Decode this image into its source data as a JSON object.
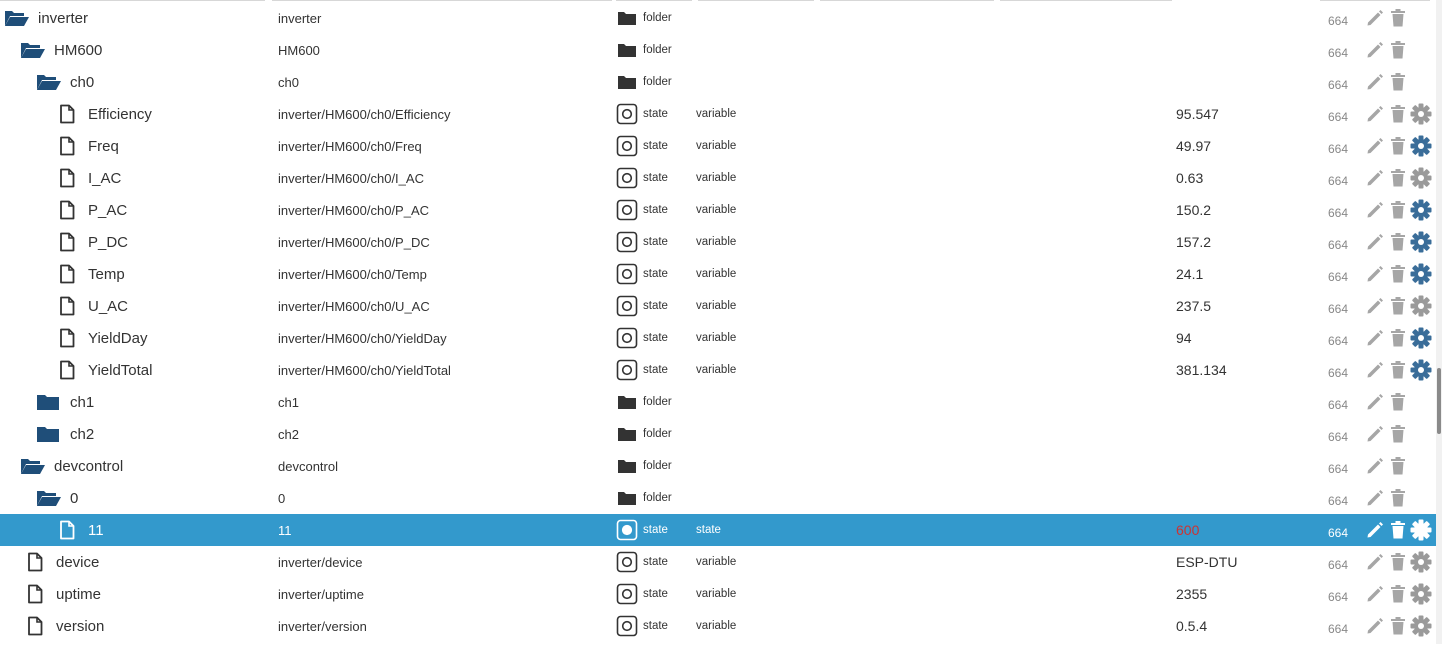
{
  "colors": {
    "folder": "#1f4e79",
    "selected_bg": "#3399cc",
    "gear_active": "#3a6d99",
    "gear_inactive": "#9a9a9a",
    "action_icon": "#a6a6a6",
    "value_red": "#cc3333"
  },
  "icons": {
    "folder_open": "folder-open-icon",
    "folder_closed": "folder-closed-icon",
    "file": "file-icon",
    "type_folder": "folder-icon",
    "type_state": "state-box-icon",
    "edit": "pencil-icon",
    "delete": "trash-icon",
    "settings": "gear-icon"
  },
  "rows": [
    {
      "name": "inverter",
      "id": "inverter",
      "type": "folder",
      "role": "",
      "value": "",
      "acl": "664",
      "kind": "folder_open",
      "depth": 0,
      "gear": "none",
      "selected": false
    },
    {
      "name": "HM600",
      "id": "HM600",
      "type": "folder",
      "role": "",
      "value": "",
      "acl": "664",
      "kind": "folder_open",
      "depth": 1,
      "gear": "none",
      "selected": false
    },
    {
      "name": "ch0",
      "id": "ch0",
      "type": "folder",
      "role": "",
      "value": "",
      "acl": "664",
      "kind": "folder_open",
      "depth": 2,
      "gear": "none",
      "selected": false
    },
    {
      "name": "Efficiency",
      "id": "inverter/HM600/ch0/Efficiency",
      "type": "state",
      "role": "variable",
      "value": "95.547",
      "acl": "664",
      "kind": "file",
      "depth": 3,
      "gear": "inactive",
      "selected": false
    },
    {
      "name": "Freq",
      "id": "inverter/HM600/ch0/Freq",
      "type": "state",
      "role": "variable",
      "value": "49.97",
      "acl": "664",
      "kind": "file",
      "depth": 3,
      "gear": "active",
      "selected": false
    },
    {
      "name": "I_AC",
      "id": "inverter/HM600/ch0/I_AC",
      "type": "state",
      "role": "variable",
      "value": "0.63",
      "acl": "664",
      "kind": "file",
      "depth": 3,
      "gear": "inactive",
      "selected": false
    },
    {
      "name": "P_AC",
      "id": "inverter/HM600/ch0/P_AC",
      "type": "state",
      "role": "variable",
      "value": "150.2",
      "acl": "664",
      "kind": "file",
      "depth": 3,
      "gear": "active",
      "selected": false
    },
    {
      "name": "P_DC",
      "id": "inverter/HM600/ch0/P_DC",
      "type": "state",
      "role": "variable",
      "value": "157.2",
      "acl": "664",
      "kind": "file",
      "depth": 3,
      "gear": "active",
      "selected": false
    },
    {
      "name": "Temp",
      "id": "inverter/HM600/ch0/Temp",
      "type": "state",
      "role": "variable",
      "value": "24.1",
      "acl": "664",
      "kind": "file",
      "depth": 3,
      "gear": "active",
      "selected": false
    },
    {
      "name": "U_AC",
      "id": "inverter/HM600/ch0/U_AC",
      "type": "state",
      "role": "variable",
      "value": "237.5",
      "acl": "664",
      "kind": "file",
      "depth": 3,
      "gear": "inactive",
      "selected": false
    },
    {
      "name": "YieldDay",
      "id": "inverter/HM600/ch0/YieldDay",
      "type": "state",
      "role": "variable",
      "value": "94",
      "acl": "664",
      "kind": "file",
      "depth": 3,
      "gear": "active",
      "selected": false
    },
    {
      "name": "YieldTotal",
      "id": "inverter/HM600/ch0/YieldTotal",
      "type": "state",
      "role": "variable",
      "value": "381.134",
      "acl": "664",
      "kind": "file",
      "depth": 3,
      "gear": "active",
      "selected": false
    },
    {
      "name": "ch1",
      "id": "ch1",
      "type": "folder",
      "role": "",
      "value": "",
      "acl": "664",
      "kind": "folder_closed",
      "depth": 2,
      "gear": "none",
      "selected": false
    },
    {
      "name": "ch2",
      "id": "ch2",
      "type": "folder",
      "role": "",
      "value": "",
      "acl": "664",
      "kind": "folder_closed",
      "depth": 2,
      "gear": "none",
      "selected": false
    },
    {
      "name": "devcontrol",
      "id": "devcontrol",
      "type": "folder",
      "role": "",
      "value": "",
      "acl": "664",
      "kind": "folder_open",
      "depth": 1,
      "gear": "none",
      "selected": false
    },
    {
      "name": "0",
      "id": "0",
      "type": "folder",
      "role": "",
      "value": "",
      "acl": "664",
      "kind": "folder_open",
      "depth": 2,
      "gear": "none",
      "selected": false
    },
    {
      "name": "11",
      "id": "11",
      "type": "state",
      "role": "state",
      "value": "600",
      "acl": "664",
      "kind": "file",
      "depth": 3,
      "gear": "active",
      "selected": true,
      "value_red": true
    },
    {
      "name": "device",
      "id": "inverter/device",
      "type": "state",
      "role": "variable",
      "value": "ESP-DTU",
      "acl": "664",
      "kind": "file",
      "depth": 1,
      "gear": "inactive",
      "selected": false
    },
    {
      "name": "uptime",
      "id": "inverter/uptime",
      "type": "state",
      "role": "variable",
      "value": "2355",
      "acl": "664",
      "kind": "file",
      "depth": 1,
      "gear": "inactive",
      "selected": false
    },
    {
      "name": "version",
      "id": "inverter/version",
      "type": "state",
      "role": "variable",
      "value": "0.5.4",
      "acl": "664",
      "kind": "file",
      "depth": 1,
      "gear": "inactive",
      "selected": false
    }
  ]
}
